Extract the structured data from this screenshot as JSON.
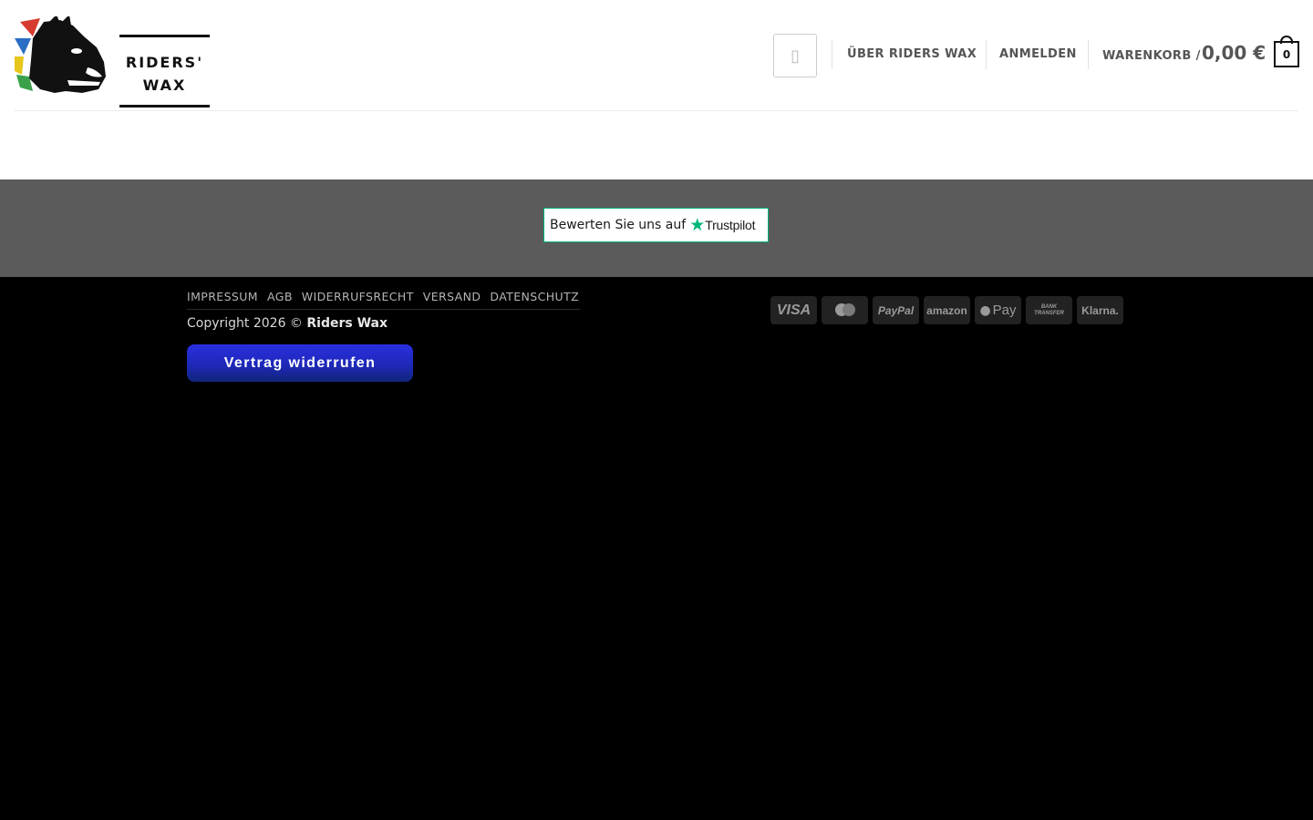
{
  "brand": {
    "logo_line1": "RIDERS'",
    "logo_line2": "WAX"
  },
  "header": {
    "search_icon": "search-icon",
    "nav": [
      {
        "label": "ÜBER RIDERS WAX"
      },
      {
        "label": "ANMELDEN"
      }
    ],
    "cart": {
      "label": "WARENKORB /",
      "total": "0,00 €",
      "count": "0"
    }
  },
  "trustpilot": {
    "text": "Bewerten Sie uns auf",
    "brand": "Trustpilot",
    "star_color": "#00b67a"
  },
  "footer": {
    "links": [
      "IMPRESSUM",
      "AGB",
      "WIDERRUFSRECHT",
      "VERSAND",
      "DATENSCHUTZ"
    ],
    "copyright_prefix": "Copyright 2026 ©",
    "copyright_owner": "Riders Wax",
    "revoke_button": "Vertrag widerrufen",
    "payment_icons": [
      "visa-icon",
      "mastercard-icon",
      "paypal-icon",
      "amazon-icon",
      "apple-pay-icon",
      "bank-transfer-icon",
      "klarna-icon"
    ],
    "payment_labels": {
      "visa": "VISA",
      "paypal": "PayPal",
      "amazon": "amazon",
      "applepay": "Pay",
      "bank1": "BANK",
      "bank2": "TRANSFER",
      "klarna": "Klarna."
    }
  },
  "colors": {
    "trust_band": "#5b5b5b",
    "footer_bg": "#000000",
    "revoke_button": "#2a2fe0"
  }
}
